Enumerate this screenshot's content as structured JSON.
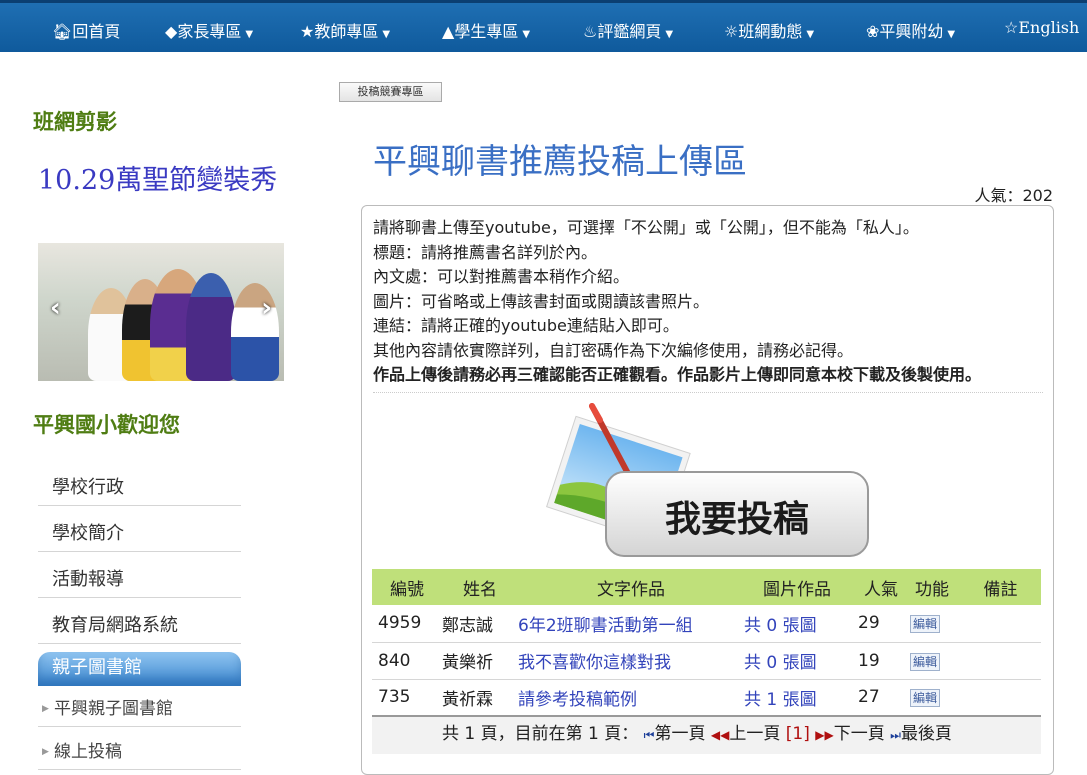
{
  "nav": {
    "home": "回首頁",
    "parent": "家長專區",
    "teacher": "教師專區",
    "student": "學生專區",
    "eval": "評鑑網頁",
    "class": "班網動態",
    "kinder": "平興附幼",
    "english": "English"
  },
  "sidebar": {
    "clip_heading": "班網剪影",
    "album_title": "10.29萬聖節變裝秀",
    "welcome_heading": "平興國小歡迎您",
    "items": [
      "學校行政",
      "學校簡介",
      "活動報導",
      "教育局網路系統",
      "親子圖書館"
    ],
    "sub_items": [
      "平興親子圖書館",
      "線上投稿"
    ]
  },
  "main": {
    "tab_label": "投稿競賽專區",
    "title": "平興聊書推薦投稿上傳區",
    "popularity": "人氣：202",
    "notes": [
      "請將聊書上傳至youtube，可選擇「不公開」或「公開」，但不能為「私人」。",
      "標題：請將推薦書名詳列於內。",
      "內文處：可以對推薦書本稍作介紹。",
      "圖片：可省略或上傳該書封面或閱讀該書照片。",
      "連結：請將正確的youtube連結貼入即可。",
      "其他內容請依實際詳列，自訂密碼作為下次編修使用，請務必記得。"
    ],
    "notes_bold": "作品上傳後請務必再三確認能否正確觀看。作品影片上傳即同意本校下載及後製使用。",
    "submit_label": "我要投稿"
  },
  "table": {
    "headers": [
      "編號",
      "姓名",
      "文字作品",
      "圖片作品",
      "人氣",
      "功能",
      "備註"
    ],
    "rows": [
      {
        "id": "4959",
        "name": "鄭志誠",
        "work": "6年2班聊書活動第一組",
        "pic": "共 0 張圖",
        "pop": "29",
        "fn": "編輯",
        "note": ""
      },
      {
        "id": "840",
        "name": "黃樂祈",
        "work": "我不喜歡你這樣對我",
        "pic": "共 0 張圖",
        "pop": "19",
        "fn": "編輯",
        "note": ""
      },
      {
        "id": "735",
        "name": "黃祈霖",
        "work": "請參考投稿範例",
        "pic": "共 1 張圖",
        "pop": "27",
        "fn": "編輯",
        "note": ""
      }
    ]
  },
  "pager": {
    "summary": "共 1 頁，目前在第 1 頁：",
    "first": "第一頁",
    "prev": "上一頁",
    "current": "[1]",
    "next": "下一頁",
    "last": "最後頁"
  },
  "colors": {
    "nav_bg": "#1a67a8",
    "heading_green": "#4f7d13",
    "title_blue": "#3a6fc4",
    "table_header": "#bfe07a",
    "link": "#3344bb"
  }
}
